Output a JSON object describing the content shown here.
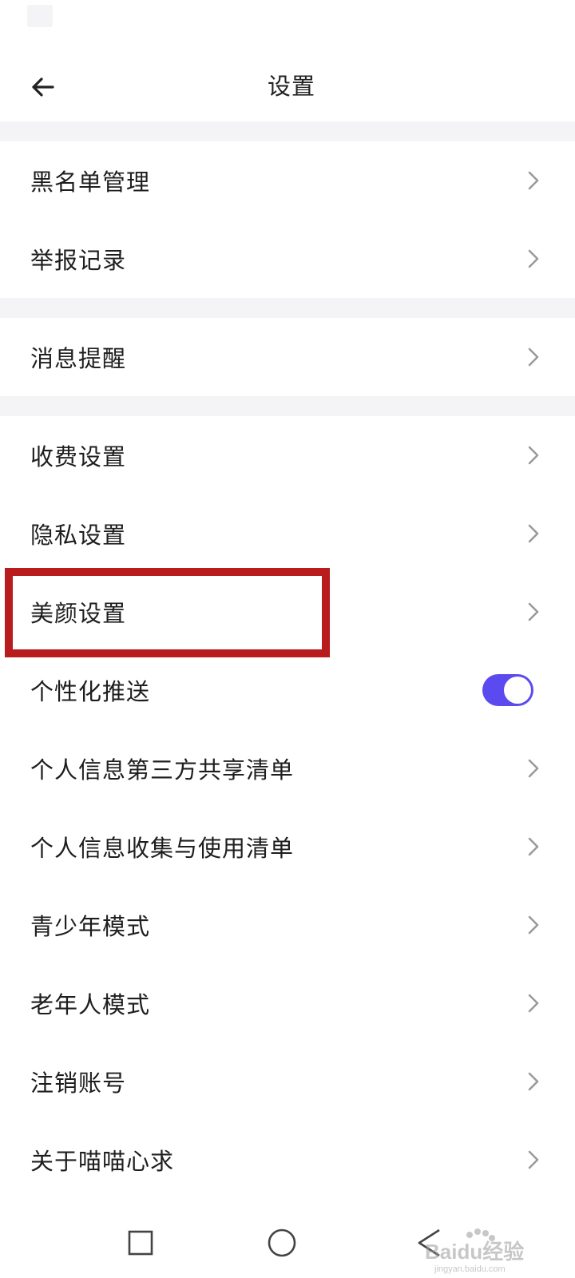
{
  "header": {
    "title": "设置",
    "back_icon": "back-arrow-icon"
  },
  "groups": [
    {
      "items": [
        {
          "label": "黑名单管理",
          "type": "chevron"
        },
        {
          "label": "举报记录",
          "type": "chevron"
        }
      ]
    },
    {
      "items": [
        {
          "label": "消息提醒",
          "type": "chevron"
        }
      ]
    },
    {
      "items": [
        {
          "label": "收费设置",
          "type": "chevron"
        },
        {
          "label": "隐私设置",
          "type": "chevron"
        },
        {
          "label": "美颜设置",
          "type": "chevron",
          "highlighted": true
        },
        {
          "label": "个性化推送",
          "type": "toggle",
          "toggle_on": true
        },
        {
          "label": "个人信息第三方共享清单",
          "type": "chevron"
        },
        {
          "label": "个人信息收集与使用清单",
          "type": "chevron"
        },
        {
          "label": "青少年模式",
          "type": "chevron"
        },
        {
          "label": "老年人模式",
          "type": "chevron"
        },
        {
          "label": "注销账号",
          "type": "chevron"
        },
        {
          "label": "关于喵喵心求",
          "type": "chevron"
        }
      ]
    }
  ],
  "colors": {
    "toggle_on": "#5b4af0",
    "highlight_border": "#b91c1c",
    "divider": "#f4f4f6",
    "chevron": "#9a9a9a"
  },
  "nav": {
    "recents_icon": "square-icon",
    "home_icon": "circle-icon",
    "back_icon": "triangle-back-icon"
  },
  "watermark": {
    "text": "Baidu经验",
    "subtext": "jingyan.baidu.com"
  }
}
